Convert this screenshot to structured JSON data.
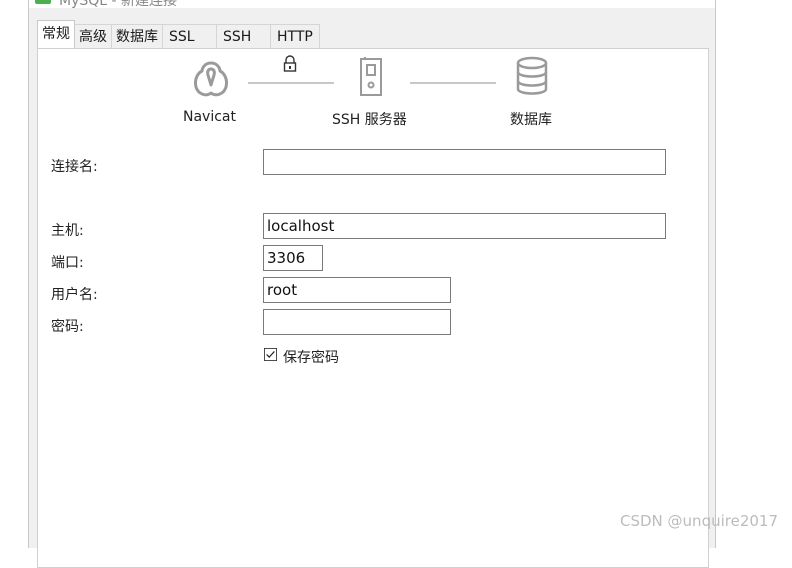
{
  "window": {
    "title": "MySQL - 新建连接",
    "close_glyph": "×"
  },
  "tabs": [
    {
      "label": "常规",
      "active": true
    },
    {
      "label": "高级",
      "active": false
    },
    {
      "label": "数据库",
      "active": false
    },
    {
      "label": "SSL",
      "active": false
    },
    {
      "label": "SSH",
      "active": false
    },
    {
      "label": "HTTP",
      "active": false
    }
  ],
  "diagram": {
    "client_label": "Navicat",
    "ssh_label": "SSH 服务器",
    "db_label": "数据库",
    "icons": [
      "navicat-logo-icon",
      "lock-icon",
      "server-icon",
      "database-icon"
    ]
  },
  "form": {
    "connection_name": {
      "label": "连接名:",
      "value": ""
    },
    "host": {
      "label": "主机:",
      "value": "localhost"
    },
    "port": {
      "label": "端口:",
      "value": "3306"
    },
    "username": {
      "label": "用户名:",
      "value": "root"
    },
    "password": {
      "label": "密码:",
      "value": ""
    },
    "save_password": {
      "label": "保存密码",
      "checked": true
    }
  },
  "watermark": "CSDN @unquire2017"
}
